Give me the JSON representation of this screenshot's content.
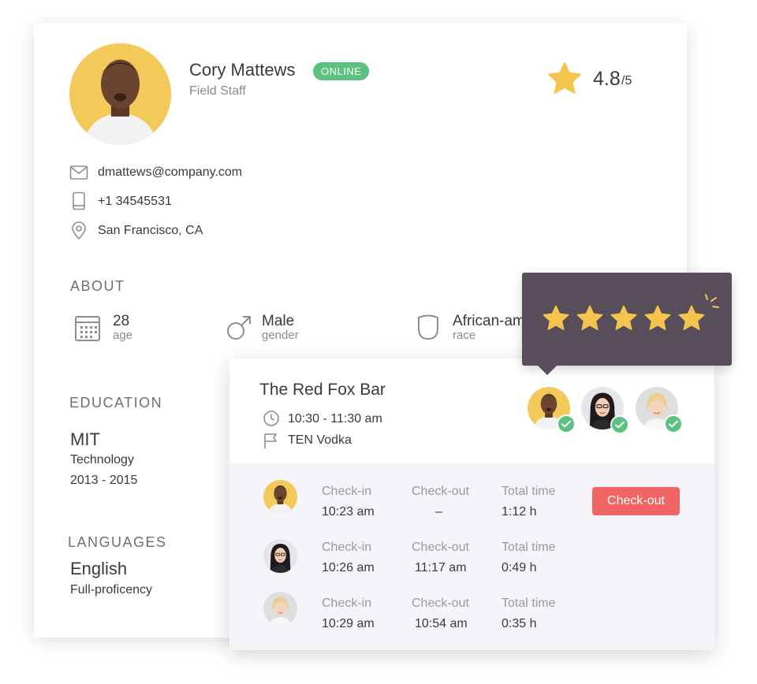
{
  "profile": {
    "name": "Cory Mattews",
    "status": "ONLINE",
    "role": "Field Staff",
    "rating_value": "4.8",
    "rating_max": "/5",
    "email": "dmattews@company.com",
    "phone": "+1 34545531",
    "location": "San Francisco, CA"
  },
  "about": {
    "title": "ABOUT",
    "age": {
      "value": "28",
      "label": "age"
    },
    "gender": {
      "value": "Male",
      "label": "gender"
    },
    "race": {
      "value": "African-am",
      "label": "race"
    }
  },
  "education": {
    "title": "EDUCATION",
    "school": "MIT",
    "field": "Technology",
    "years": "2013 - 2015"
  },
  "languages": {
    "title": "LANGUAGES",
    "name": "English",
    "level": "Full-proficency"
  },
  "event": {
    "venue": "The Red Fox Bar",
    "time": "10:30 - 11:30 am",
    "brand": "TEN Vodka"
  },
  "shifts": [
    {
      "checkin_label": "Check-in",
      "checkin": "10:23 am",
      "checkout_label": "Check-out",
      "checkout": "–",
      "total_label": "Total time",
      "total": "1:12 h"
    },
    {
      "checkin_label": "Check-in",
      "checkin": "10:26 am",
      "checkout_label": "Check-out",
      "checkout": "11:17 am",
      "total_label": "Total time",
      "total": "0:49 h"
    },
    {
      "checkin_label": "Check-in",
      "checkin": "10:29 am",
      "checkout_label": "Check-out",
      "checkout": "10:54 am",
      "total_label": "Total time",
      "total": "0:35 h"
    }
  ],
  "checkout_button": "Check-out",
  "tooltip": {
    "stars": 5
  },
  "colors": {
    "accent_yellow": "#f5c44e",
    "online_green": "#5ac17f",
    "checkout_red": "#f16565",
    "tooltip_bg": "#574e5a"
  }
}
